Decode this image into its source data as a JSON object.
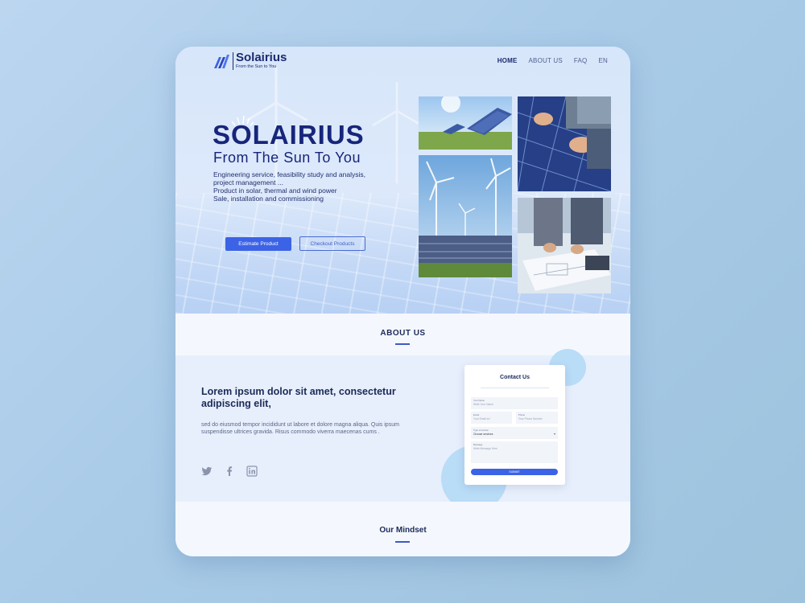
{
  "brand": {
    "name": "Solairius",
    "tagline": "From the Sun to You"
  },
  "nav": {
    "items": [
      "HOME",
      "ABOUT US",
      "FAQ",
      "EN"
    ],
    "active": "HOME"
  },
  "hero": {
    "title": "SOLAIRIUS",
    "subtitle": "From The Sun To You",
    "lines": [
      "Engineering service, feasibility study and analysis,",
      "project management ...",
      "Product in solar, thermal and wind power",
      "Sale, installation and commissioning"
    ],
    "primary_button": "Estimate Product",
    "secondary_button": "Checkout Products"
  },
  "about": {
    "title": "ABOUT US",
    "heading": "Lorem ipsum dolor sit amet, consectetur adipiscing elit,",
    "text": "sed do eiusmod tempor incididunt ut labore et dolore magna aliqua. Quis ipsum suspendisse ultrices gravida. Risus commodo viverra maecenas cums ."
  },
  "socials": [
    "twitter-icon",
    "facebook-icon",
    "linkedin-icon"
  ],
  "contact_form": {
    "title": "Contact Us",
    "fields": [
      {
        "label": "Your Name",
        "placeholder": "Write Your Name"
      },
      {
        "label": "Email",
        "placeholder": "Your Email ed"
      },
      {
        "label": "Phone",
        "placeholder": "Your Phone Number"
      },
      {
        "label": "Type of service",
        "value": "Choose services"
      },
      {
        "label": "Message",
        "placeholder": "Write Message Here"
      }
    ],
    "submit": "SUBMIT"
  },
  "mindset": {
    "title": "Our Mindset"
  },
  "colors": {
    "accent": "#3c63e6",
    "brand_navy": "#17257a",
    "background": "#a9cbe8"
  }
}
